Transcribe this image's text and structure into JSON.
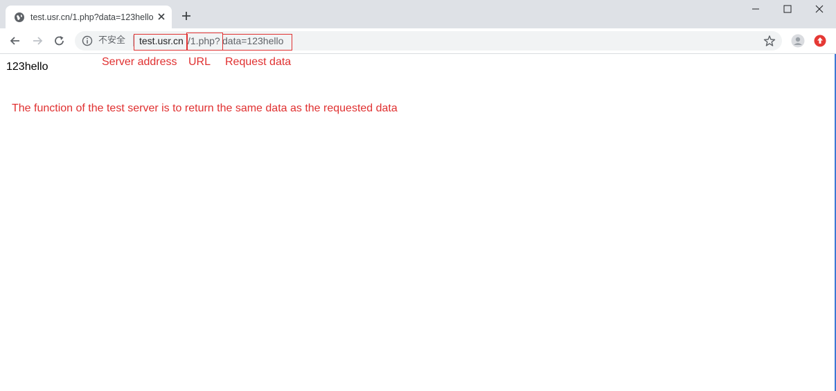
{
  "tab": {
    "title": "test.usr.cn/1.php?data=123hello"
  },
  "omnibox": {
    "security_label": "不安全",
    "url_host": "test.usr.cn",
    "url_path": "/1.php?",
    "url_query": "data=123hello"
  },
  "page": {
    "body_text": "123hello"
  },
  "annotations": {
    "server_address": "Server address",
    "url": "URL",
    "request_data": "Request data",
    "note": "The function of the test server is to return the same data as the requested data"
  },
  "colors": {
    "annotation": "#e03030",
    "tabstrip": "#dee1e6",
    "omnibox": "#f1f3f4",
    "extension": "#e53935"
  },
  "icons": [
    "globe-icon",
    "close-icon",
    "plus-icon",
    "minimize-icon",
    "maximize-icon",
    "close-window-icon",
    "back-arrow-icon",
    "forward-arrow-icon",
    "reload-icon",
    "info-icon",
    "star-icon",
    "profile-icon",
    "extension-icon"
  ]
}
